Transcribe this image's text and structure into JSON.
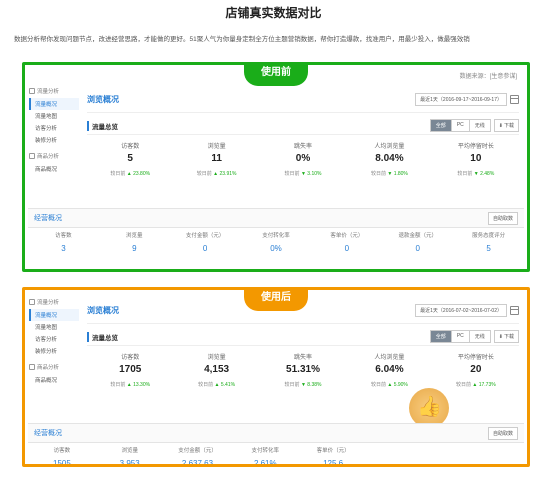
{
  "header": {
    "title": "店铺真实数据对比",
    "subtitle": "数据分析帮你发现问题节点，改进经营思路，才能做的更好。51聚人气为你量身定制全方位主题营销数据，帮你打造爆款，找准用户，用最少投入，做最强效销"
  },
  "before": {
    "badge": "使用前",
    "source": "数据来源：[生意参谋]",
    "sidebar": {
      "groups": [
        {
          "title": "流量分析",
          "items": [
            {
              "label": "流量概况"
            },
            {
              "label": "流量地图"
            },
            {
              "label": "访客分析"
            },
            {
              "label": "装修分析"
            }
          ]
        },
        {
          "title": "商品分析",
          "items": [
            {
              "label": "商品概况"
            }
          ]
        }
      ]
    },
    "overview_title": "浏览概况",
    "date_range": "最近1天（2016-09-17~2016-09-17）",
    "flow_title": "流量总览",
    "segments": [
      "全部",
      "PC",
      "无线"
    ],
    "download": "下载",
    "metrics": [
      {
        "label": "访客数",
        "value": "5",
        "cmp_label": "较日前",
        "delta": "▲ 23.80%"
      },
      {
        "label": "浏览量",
        "value": "11",
        "cmp_label": "较日前",
        "delta": "▲ 23.91%"
      },
      {
        "label": "跳失率",
        "value": "0%",
        "cmp_label": "较日前",
        "delta": "▼ 3.10%"
      },
      {
        "label": "人均浏览量",
        "value": "8.04%",
        "cmp_label": "较日前",
        "delta": "▼ 1.80%"
      },
      {
        "label": "平均停留时长",
        "value": "10",
        "cmp_label": "较日前",
        "delta": "▼ 2.48%"
      }
    ],
    "ops_title": "经营概况",
    "ops_button": "自助取数",
    "ops": [
      {
        "label": "访客数",
        "value": "3"
      },
      {
        "label": "浏览量",
        "value": "9"
      },
      {
        "label": "支付金额（元）",
        "value": "0"
      },
      {
        "label": "支付转化率",
        "value": "0%"
      },
      {
        "label": "客单价（元）",
        "value": "0"
      },
      {
        "label": "退款金额（元）",
        "value": "0"
      },
      {
        "label": "服务态度评分",
        "value": "5"
      }
    ]
  },
  "after": {
    "badge": "使用后",
    "sidebar": {
      "groups": [
        {
          "title": "流量分析",
          "items": [
            {
              "label": "流量概况"
            },
            {
              "label": "流量地图"
            },
            {
              "label": "访客分析"
            },
            {
              "label": "装修分析"
            }
          ]
        },
        {
          "title": "商品分析",
          "items": [
            {
              "label": "商品概况"
            }
          ]
        }
      ]
    },
    "overview_title": "浏览概况",
    "date_range": "最近1天（2016-07-02~2016-07-02）",
    "flow_title": "流量总览",
    "segments": [
      "全部",
      "PC",
      "无线"
    ],
    "download": "下载",
    "metrics": [
      {
        "label": "访客数",
        "value": "1705",
        "cmp_label": "较日前",
        "delta": "▲ 13.30%"
      },
      {
        "label": "浏览量",
        "value": "4,153",
        "cmp_label": "较日前",
        "delta": "▲ 5.41%"
      },
      {
        "label": "跳失率",
        "value": "51.31%",
        "cmp_label": "较日前",
        "delta": "▼ 8.38%"
      },
      {
        "label": "人均浏览量",
        "value": "6.04%",
        "cmp_label": "较日前",
        "delta": "▲ 5.90%"
      },
      {
        "label": "平均停留时长",
        "value": "20",
        "cmp_label": "较日前",
        "delta": "▲ 17.73%"
      }
    ],
    "ops_title": "经营概况",
    "ops_button": "自助取数",
    "ops": [
      {
        "label": "访客数",
        "value": "1505"
      },
      {
        "label": "浏览量",
        "value": "3,953"
      },
      {
        "label": "支付金额（元）",
        "value": "2,637.63"
      },
      {
        "label": "支付转化率",
        "value": "2.61%"
      },
      {
        "label": "客单价（元）",
        "value": "125.6"
      }
    ]
  },
  "colors": {
    "before_accent": "#1aad19",
    "after_accent": "#f39800",
    "link_blue": "#2a7fd4"
  },
  "icons": [
    "eye-icon",
    "box-icon",
    "calendar-icon",
    "download-icon",
    "thumbs-up-icon"
  ]
}
